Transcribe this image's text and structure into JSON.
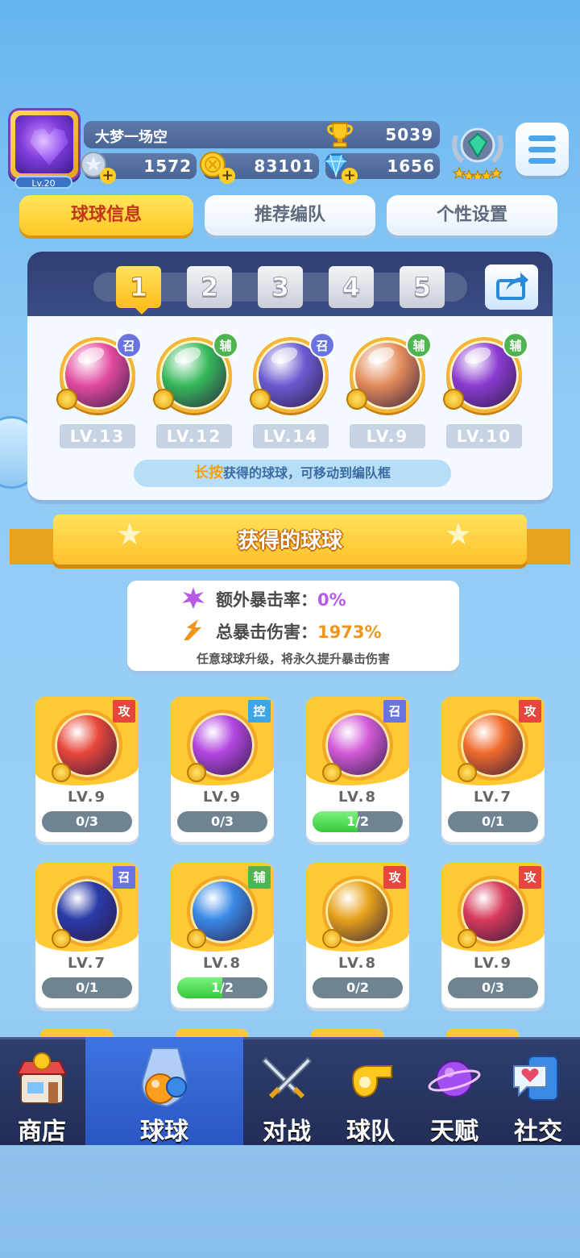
{
  "player": {
    "name": "大梦一场空",
    "level": "Lv.20",
    "trophies": "5039",
    "silver": "1572",
    "gold": "83101",
    "gems": "1656"
  },
  "tabs": [
    "球球信息",
    "推荐编队",
    "个性设置"
  ],
  "team": {
    "numbers": [
      "1",
      "2",
      "3",
      "4",
      "5"
    ],
    "selected": "1",
    "slots": [
      {
        "level": "LV.13",
        "tag": "召",
        "color": "#e24aa0"
      },
      {
        "level": "LV.12",
        "tag": "辅",
        "color": "#36b85a"
      },
      {
        "level": "LV.14",
        "tag": "召",
        "color": "#6b5ad0"
      },
      {
        "level": "LV.9",
        "tag": "辅",
        "color": "#e28a5a"
      },
      {
        "level": "LV.10",
        "tag": "辅",
        "color": "#8a3bd0"
      }
    ],
    "hint_emphasis": "长按",
    "hint_text": "获得的球球，可移动到编队框"
  },
  "section_title": "获得的球球",
  "crit": {
    "extra_label": "额外暴击率：",
    "extra_value": "0%",
    "total_label": "总暴击伤害：",
    "total_value": "1973%",
    "note": "任意球球升级，将永久提升暴击伤害"
  },
  "balls": [
    {
      "level": "LV.9",
      "progress": "0/3",
      "fill": 0.0,
      "tag": "攻",
      "color": "#e8463a"
    },
    {
      "level": "LV.9",
      "progress": "0/3",
      "fill": 0.0,
      "tag": "控",
      "color": "#b246e0"
    },
    {
      "level": "LV.8",
      "progress": "1/2",
      "fill": 0.5,
      "tag": "召",
      "color": "#d25ad8"
    },
    {
      "level": "LV.7",
      "progress": "0/1",
      "fill": 0.0,
      "tag": "攻",
      "color": "#f06a2a"
    },
    {
      "level": "LV.7",
      "progress": "0/1",
      "fill": 0.0,
      "tag": "召",
      "color": "#2a3aa8"
    },
    {
      "level": "LV.8",
      "progress": "1/2",
      "fill": 0.5,
      "tag": "辅",
      "color": "#3a8ae8"
    },
    {
      "level": "LV.8",
      "progress": "0/2",
      "fill": 0.0,
      "tag": "攻",
      "color": "#e8a21a"
    },
    {
      "level": "LV.9",
      "progress": "0/3",
      "fill": 0.0,
      "tag": "攻",
      "color": "#d83a5a"
    }
  ],
  "nav": [
    "商店",
    "球球",
    "对战",
    "球队",
    "天赋",
    "社交"
  ],
  "nav_active": "球球",
  "icons": {
    "trophy": "trophy-icon",
    "silver": "silver-coin-icon",
    "gold": "gold-coin-icon",
    "gem": "gem-icon",
    "rank": "rank-badge-icon",
    "menu": "menu-icon",
    "share": "share-icon"
  }
}
